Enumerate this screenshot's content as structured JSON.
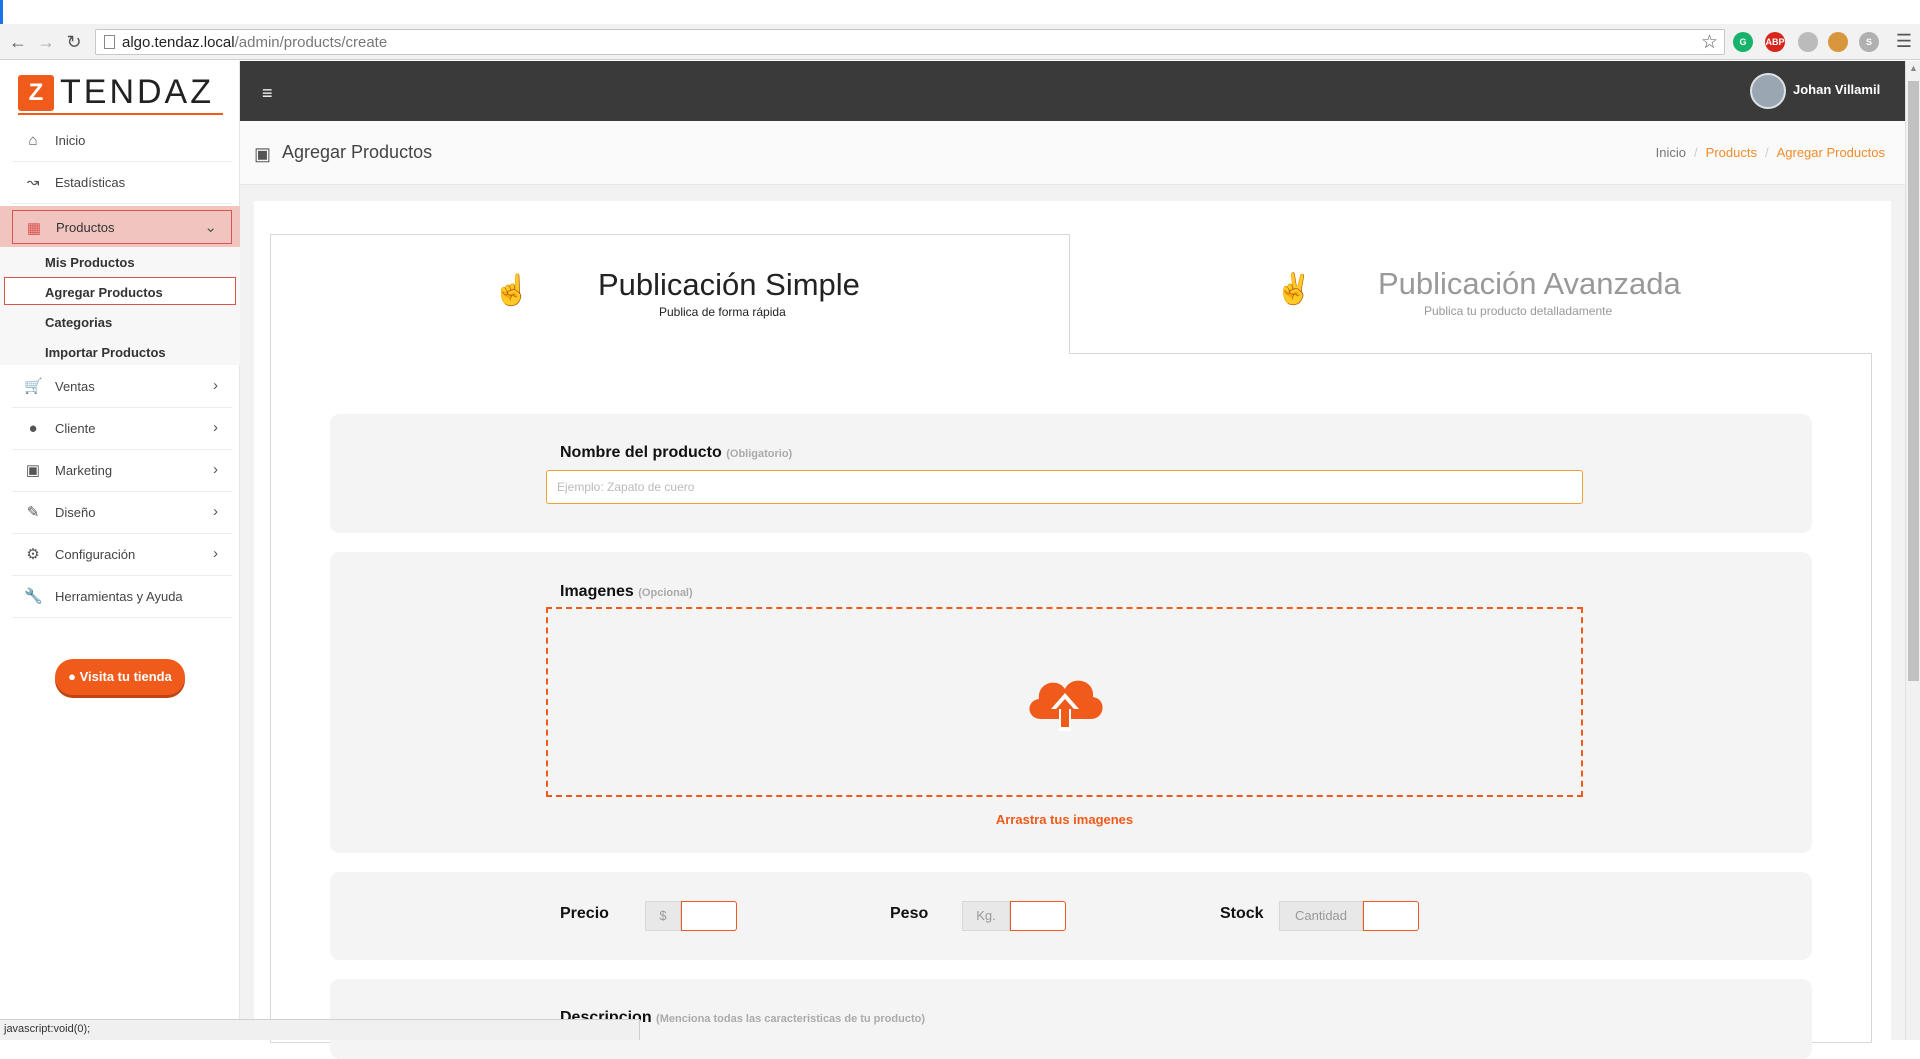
{
  "browser": {
    "url_host": "algo.tendaz.local",
    "url_path": "/admin/products/create",
    "status_text": "javascript:void(0);",
    "extensions": [
      {
        "name": "grammarly-icon",
        "label": "G",
        "color": "#16b36b"
      },
      {
        "name": "adblock-icon",
        "label": "ABP",
        "color": "#d9261c"
      },
      {
        "name": "puzzle-icon",
        "label": "",
        "color": "#bbbbbb"
      },
      {
        "name": "cookie-icon",
        "label": "",
        "color": "#d8973c"
      },
      {
        "name": "skype-icon",
        "label": "S",
        "color": "#b0b0b0"
      }
    ]
  },
  "brand": {
    "name": "TENDAZ",
    "mark": "Z",
    "accent": "#f05a1a"
  },
  "user": {
    "name": "Johan Villamil"
  },
  "sidebar": {
    "items": [
      {
        "label": "Inicio",
        "icon": "home-icon"
      },
      {
        "label": "Estadísticas",
        "icon": "chart-icon"
      },
      {
        "label": "Productos",
        "icon": "grid-icon"
      },
      {
        "label": "Ventas",
        "icon": "cart-icon"
      },
      {
        "label": "Cliente",
        "icon": "user-icon"
      },
      {
        "label": "Marketing",
        "icon": "monitor-icon"
      },
      {
        "label": "Diseño",
        "icon": "pencil-icon"
      },
      {
        "label": "Configuración",
        "icon": "cog-icon"
      },
      {
        "label": "Herramientas y Ayuda",
        "icon": "wrench-icon"
      }
    ],
    "submenu": [
      "Mis Productos",
      "Agregar Productos",
      "Categorias",
      "Importar Productos"
    ],
    "visit_button": "Visita tu tienda"
  },
  "page": {
    "title": "Agregar Productos",
    "breadcrumb": [
      "Inicio",
      "Products",
      "Agregar Productos"
    ]
  },
  "tabs": {
    "simple": {
      "title": "Publicación Simple",
      "subtitle": "Publica de forma rápida"
    },
    "advanced": {
      "title": "Publicación Avanzada",
      "subtitle": "Publica tu producto detalladamente"
    }
  },
  "form": {
    "name_label": "Nombre del producto",
    "name_hint": "(Obligatorio)",
    "name_placeholder": "Ejemplo: Zapato de cuero",
    "images_label": "Imagenes",
    "images_hint": "(Opcional)",
    "images_caption": "Arrastra tus imagenes",
    "price_label": "Precio",
    "price_addon": "$",
    "weight_label": "Peso",
    "weight_addon": "Kg.",
    "stock_label": "Stock",
    "stock_addon": "Cantidad",
    "description_label": "Descripcion",
    "description_hint": "(Menciona todas las caracteristicas de tu producto)"
  }
}
